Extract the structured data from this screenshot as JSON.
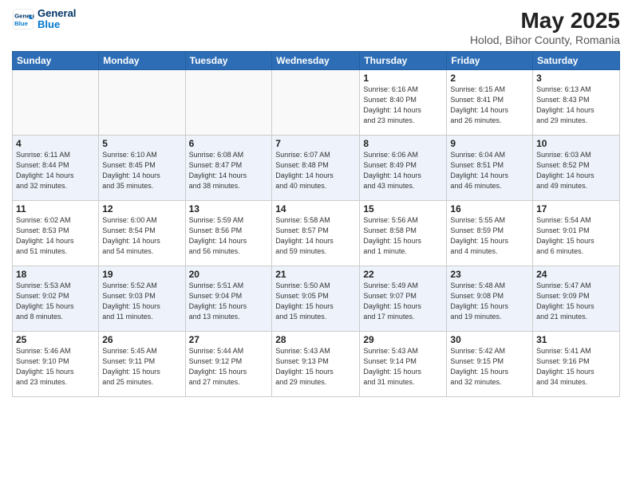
{
  "header": {
    "logo_line1": "General",
    "logo_line2": "Blue",
    "title": "May 2025",
    "subtitle": "Holod, Bihor County, Romania"
  },
  "weekdays": [
    "Sunday",
    "Monday",
    "Tuesday",
    "Wednesday",
    "Thursday",
    "Friday",
    "Saturday"
  ],
  "weeks": [
    [
      {
        "day": "",
        "info": ""
      },
      {
        "day": "",
        "info": ""
      },
      {
        "day": "",
        "info": ""
      },
      {
        "day": "",
        "info": ""
      },
      {
        "day": "1",
        "info": "Sunrise: 6:16 AM\nSunset: 8:40 PM\nDaylight: 14 hours\nand 23 minutes."
      },
      {
        "day": "2",
        "info": "Sunrise: 6:15 AM\nSunset: 8:41 PM\nDaylight: 14 hours\nand 26 minutes."
      },
      {
        "day": "3",
        "info": "Sunrise: 6:13 AM\nSunset: 8:43 PM\nDaylight: 14 hours\nand 29 minutes."
      }
    ],
    [
      {
        "day": "4",
        "info": "Sunrise: 6:11 AM\nSunset: 8:44 PM\nDaylight: 14 hours\nand 32 minutes."
      },
      {
        "day": "5",
        "info": "Sunrise: 6:10 AM\nSunset: 8:45 PM\nDaylight: 14 hours\nand 35 minutes."
      },
      {
        "day": "6",
        "info": "Sunrise: 6:08 AM\nSunset: 8:47 PM\nDaylight: 14 hours\nand 38 minutes."
      },
      {
        "day": "7",
        "info": "Sunrise: 6:07 AM\nSunset: 8:48 PM\nDaylight: 14 hours\nand 40 minutes."
      },
      {
        "day": "8",
        "info": "Sunrise: 6:06 AM\nSunset: 8:49 PM\nDaylight: 14 hours\nand 43 minutes."
      },
      {
        "day": "9",
        "info": "Sunrise: 6:04 AM\nSunset: 8:51 PM\nDaylight: 14 hours\nand 46 minutes."
      },
      {
        "day": "10",
        "info": "Sunrise: 6:03 AM\nSunset: 8:52 PM\nDaylight: 14 hours\nand 49 minutes."
      }
    ],
    [
      {
        "day": "11",
        "info": "Sunrise: 6:02 AM\nSunset: 8:53 PM\nDaylight: 14 hours\nand 51 minutes."
      },
      {
        "day": "12",
        "info": "Sunrise: 6:00 AM\nSunset: 8:54 PM\nDaylight: 14 hours\nand 54 minutes."
      },
      {
        "day": "13",
        "info": "Sunrise: 5:59 AM\nSunset: 8:56 PM\nDaylight: 14 hours\nand 56 minutes."
      },
      {
        "day": "14",
        "info": "Sunrise: 5:58 AM\nSunset: 8:57 PM\nDaylight: 14 hours\nand 59 minutes."
      },
      {
        "day": "15",
        "info": "Sunrise: 5:56 AM\nSunset: 8:58 PM\nDaylight: 15 hours\nand 1 minute."
      },
      {
        "day": "16",
        "info": "Sunrise: 5:55 AM\nSunset: 8:59 PM\nDaylight: 15 hours\nand 4 minutes."
      },
      {
        "day": "17",
        "info": "Sunrise: 5:54 AM\nSunset: 9:01 PM\nDaylight: 15 hours\nand 6 minutes."
      }
    ],
    [
      {
        "day": "18",
        "info": "Sunrise: 5:53 AM\nSunset: 9:02 PM\nDaylight: 15 hours\nand 8 minutes."
      },
      {
        "day": "19",
        "info": "Sunrise: 5:52 AM\nSunset: 9:03 PM\nDaylight: 15 hours\nand 11 minutes."
      },
      {
        "day": "20",
        "info": "Sunrise: 5:51 AM\nSunset: 9:04 PM\nDaylight: 15 hours\nand 13 minutes."
      },
      {
        "day": "21",
        "info": "Sunrise: 5:50 AM\nSunset: 9:05 PM\nDaylight: 15 hours\nand 15 minutes."
      },
      {
        "day": "22",
        "info": "Sunrise: 5:49 AM\nSunset: 9:07 PM\nDaylight: 15 hours\nand 17 minutes."
      },
      {
        "day": "23",
        "info": "Sunrise: 5:48 AM\nSunset: 9:08 PM\nDaylight: 15 hours\nand 19 minutes."
      },
      {
        "day": "24",
        "info": "Sunrise: 5:47 AM\nSunset: 9:09 PM\nDaylight: 15 hours\nand 21 minutes."
      }
    ],
    [
      {
        "day": "25",
        "info": "Sunrise: 5:46 AM\nSunset: 9:10 PM\nDaylight: 15 hours\nand 23 minutes."
      },
      {
        "day": "26",
        "info": "Sunrise: 5:45 AM\nSunset: 9:11 PM\nDaylight: 15 hours\nand 25 minutes."
      },
      {
        "day": "27",
        "info": "Sunrise: 5:44 AM\nSunset: 9:12 PM\nDaylight: 15 hours\nand 27 minutes."
      },
      {
        "day": "28",
        "info": "Sunrise: 5:43 AM\nSunset: 9:13 PM\nDaylight: 15 hours\nand 29 minutes."
      },
      {
        "day": "29",
        "info": "Sunrise: 5:43 AM\nSunset: 9:14 PM\nDaylight: 15 hours\nand 31 minutes."
      },
      {
        "day": "30",
        "info": "Sunrise: 5:42 AM\nSunset: 9:15 PM\nDaylight: 15 hours\nand 32 minutes."
      },
      {
        "day": "31",
        "info": "Sunrise: 5:41 AM\nSunset: 9:16 PM\nDaylight: 15 hours\nand 34 minutes."
      }
    ]
  ]
}
